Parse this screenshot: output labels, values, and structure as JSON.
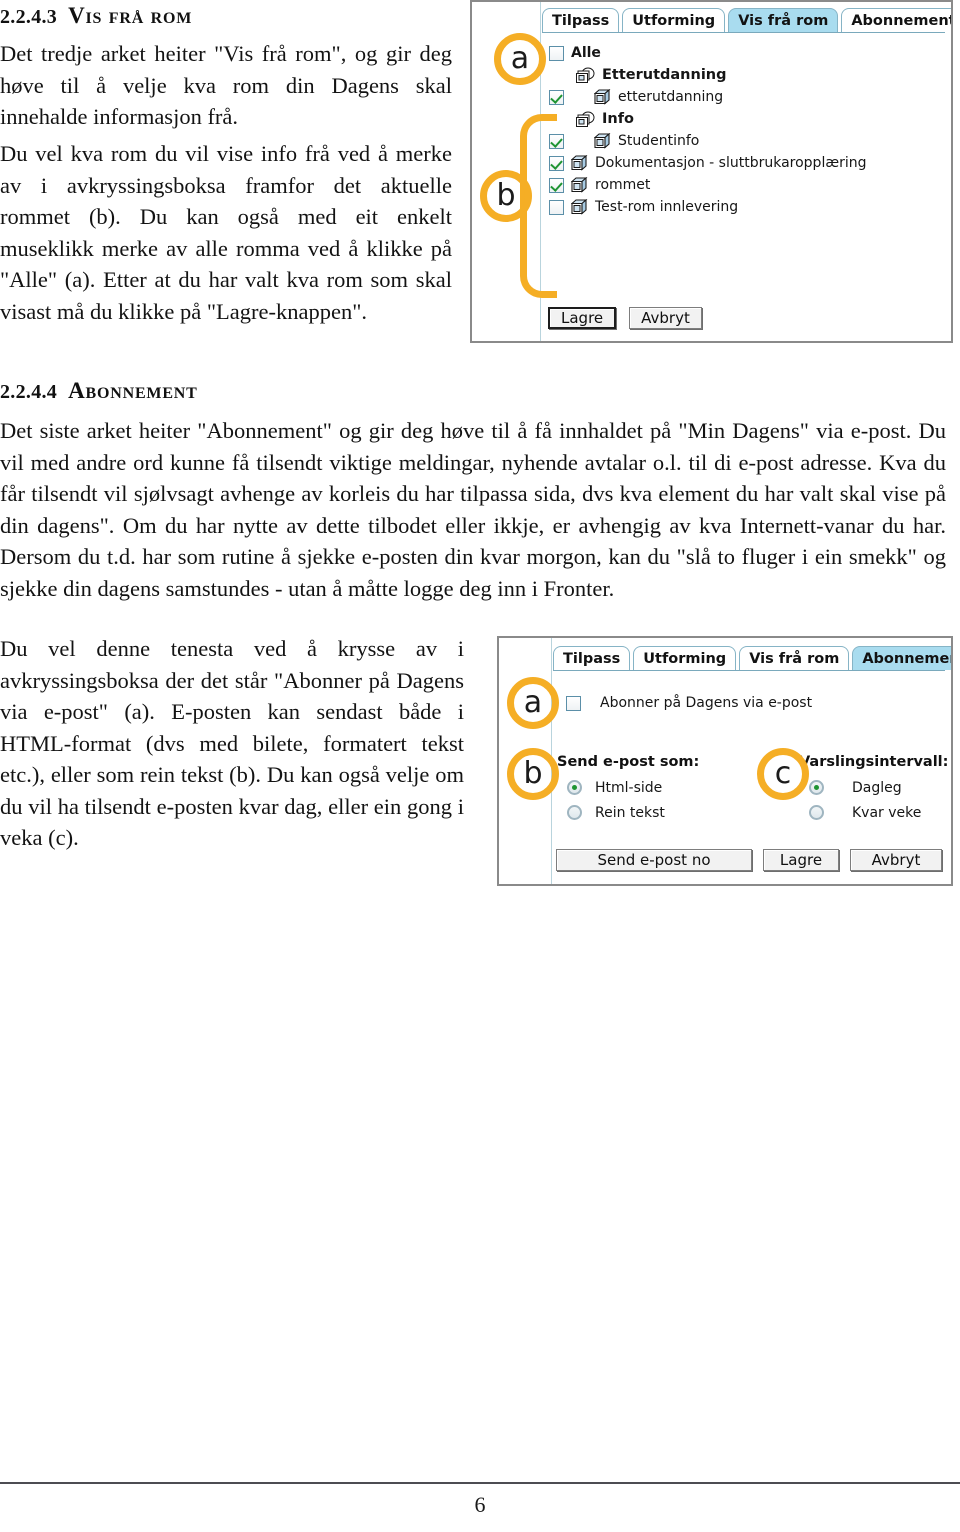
{
  "document": {
    "page_number": "6"
  },
  "sections": [
    {
      "number": "2.2.4.3",
      "title": "Vis frå rom",
      "paragraphs": [
        "Det tredje arket heiter \"Vis frå rom\", og gir deg høve til å velje kva rom din Dagens skal innehalde informasjon frå.",
        "Du vel kva rom du vil vise info frå ved å merke av i avkryssingsboksa framfor det aktuelle rommet (b). Du kan også med eit enkelt museklikk merke av alle romma ved å klikke på \"Alle\" (a). Etter at du har valt kva rom som skal visast må du klikke på \"Lagre-knappen\"."
      ]
    },
    {
      "number": "2.2.4.4",
      "title": "Abonnement",
      "paragraphs": [
        "Det siste arket heiter \"Abonnement\" og gir deg høve til å få innhaldet på \"Min Dagens\" via e-post. Du vil med andre ord kunne få tilsendt viktige meldingar, nyhende avtalar o.l. til di e-post adresse. Kva du får tilsendt vil sjølvsagt avhenge av korleis du har tilpassa sida, dvs kva element du har valt skal vise på din dagens\". Om du har nytte av dette tilbodet eller ikkje, er avhengig av kva Internett-vanar du har. Dersom du t.d. har som rutine å sjekke e-posten din kvar morgon, kan du \"slå to fluger i ein smekk\" og sjekke din dagens samstundes - utan å måtte logge deg inn i Fronter.",
        "Du vel denne tenesta ved å krysse av i avkryssingsboksa der det står \"Abonner på Dagens via e-post\" (a). E-posten kan sendast både i HTML-format (dvs med bilete, formatert tekst etc.), eller som rein tekst (b). Du kan også velje om du vil ha tilsendt e-posten kvar dag, eller ein gong i veka (c)."
      ]
    }
  ],
  "screenshot_rooms": {
    "callouts": [
      {
        "id": "a",
        "label": "a"
      },
      {
        "id": "b",
        "label": "b"
      }
    ],
    "tabs": [
      {
        "label": "Tilpass",
        "active": false
      },
      {
        "label": "Utforming",
        "active": false
      },
      {
        "label": "Vis frå rom",
        "active": true
      },
      {
        "label": "Abonnement",
        "active": false
      }
    ],
    "tree": [
      {
        "type": "all",
        "label": "Alle",
        "checked": false,
        "icon": "checkbox-icon"
      },
      {
        "type": "group",
        "label": "Etterutdanning",
        "icon": "folder-stack-icon"
      },
      {
        "type": "room",
        "label": "etterutdanning",
        "checked": true,
        "icon": "room-cube-icon"
      },
      {
        "type": "group",
        "label": "Info",
        "icon": "folder-stack-icon"
      },
      {
        "type": "room",
        "label": "Studentinfo",
        "checked": true,
        "icon": "room-cube-icon"
      },
      {
        "type": "room2",
        "label": "Dokumentasjon - sluttbrukaropplæring",
        "checked": true,
        "icon": "room-cube-icon"
      },
      {
        "type": "room2",
        "label": "rommet",
        "checked": true,
        "icon": "room-cube-icon"
      },
      {
        "type": "room2",
        "label": "Test-rom innlevering",
        "checked": false,
        "icon": "room-cube-icon"
      }
    ],
    "buttons": [
      {
        "label": "Lagre",
        "default": true
      },
      {
        "label": "Avbryt",
        "default": false
      }
    ]
  },
  "screenshot_subscription": {
    "callouts": [
      {
        "id": "a",
        "label": "a"
      },
      {
        "id": "b",
        "label": "b"
      },
      {
        "id": "c",
        "label": "c"
      }
    ],
    "tabs": [
      {
        "label": "Tilpass",
        "active": false
      },
      {
        "label": "Utforming",
        "active": false
      },
      {
        "label": "Vis frå rom",
        "active": false
      },
      {
        "label": "Abonnement",
        "active": true
      }
    ],
    "subscribe_checkbox": {
      "label": "Abonner på Dagens via e-post",
      "checked": false
    },
    "format_group": {
      "legend": "Send e-post som:",
      "options": [
        {
          "label": "Html-side",
          "selected": true
        },
        {
          "label": "Rein tekst",
          "selected": false
        }
      ]
    },
    "interval_group": {
      "legend": "Varslingsintervall:",
      "options": [
        {
          "label": "Dagleg",
          "selected": true
        },
        {
          "label": "Kvar veke",
          "selected": false
        }
      ]
    },
    "buttons": [
      {
        "label": "Send e-post no",
        "default": false
      },
      {
        "label": "Lagre",
        "default": false
      },
      {
        "label": "Avbryt",
        "default": false
      }
    ]
  },
  "colors": {
    "callout": "#f5ae25",
    "tab_active": "#a9dcef",
    "tab_border": "#86b4c6",
    "check_green": "#1f9433",
    "frame": "#8a8a8a"
  }
}
